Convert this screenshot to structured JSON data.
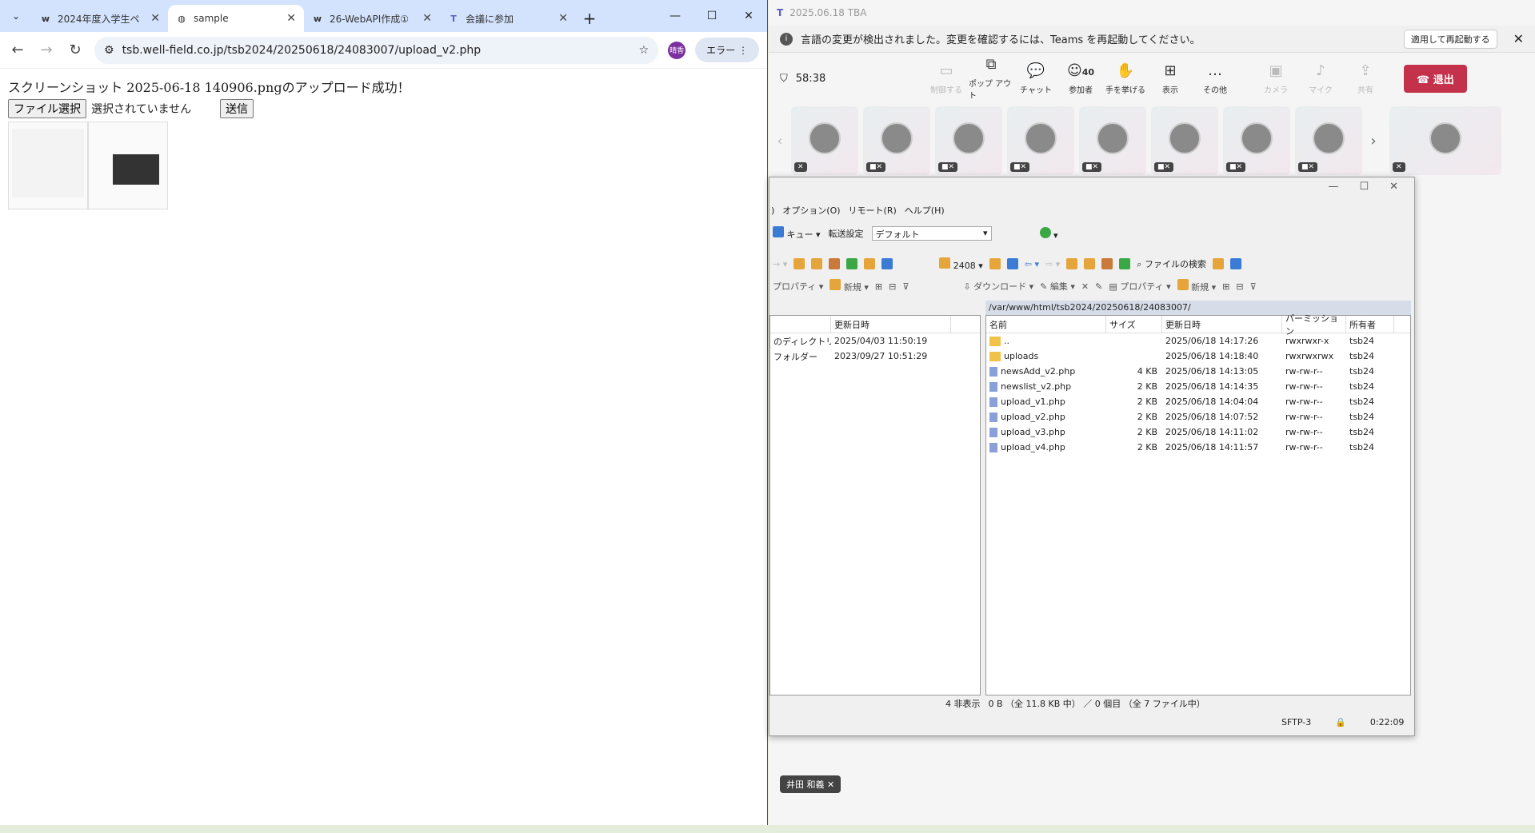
{
  "browser": {
    "tabs": [
      {
        "icon": "w",
        "title": "2024年度入学生ペ"
      },
      {
        "icon": "globe",
        "title": "sample"
      },
      {
        "icon": "w",
        "title": "26-WebAPI作成①"
      },
      {
        "icon": "teams",
        "title": "会議に参加"
      }
    ],
    "url": "tsb.well-field.co.jp/tsb2024/20250618/24083007/upload_v2.php",
    "profile": "晴香",
    "error_label": "エラー",
    "page": {
      "message": "スクリーンショット 2025-06-18 140906.pngのアップロード成功！",
      "file_button": "ファイル選択",
      "no_file": "選択されていません",
      "submit": "送信"
    }
  },
  "teams": {
    "title": "2025.06.18 TBA",
    "notice": "言語の変更が検出されました。変更を確認するには、Teams を再起動してください。",
    "restart_btn": "適用して再起動する",
    "timer": "58:38",
    "buttons": [
      {
        "label": "制御する",
        "icon": "control"
      },
      {
        "label": "ポップ アウト",
        "icon": "popout"
      },
      {
        "label": "チャット",
        "icon": "chat"
      },
      {
        "label": "参加者",
        "icon": "people",
        "count": "40"
      },
      {
        "label": "手を挙げる",
        "icon": "hand"
      },
      {
        "label": "表示",
        "icon": "grid"
      },
      {
        "label": "その他",
        "icon": "more"
      },
      {
        "label": "カメラ",
        "icon": "camera"
      },
      {
        "label": "マイク",
        "icon": "mic"
      },
      {
        "label": "共有",
        "icon": "share"
      }
    ],
    "leave": "退出",
    "participant_name": "井田 和義"
  },
  "ftp": {
    "menu": [
      "オプション(O)",
      "リモート(R)",
      "ヘルプ(H)"
    ],
    "queue": "キュー",
    "transfer_label": "転送設定",
    "transfer_value": "デフォルト",
    "dir_name": "2408",
    "find_files": "ファイルの検索",
    "download": "ダウンロード",
    "edit": "編集",
    "properties_left": "プロパティ",
    "properties_right": "プロパティ",
    "new_left": "新規",
    "new_right": "新規",
    "remote_path": "/var/www/html/tsb2024/20250618/24083007/",
    "left_header_date": "更新日時",
    "left_rows": [
      {
        "name": "のディレクトリ",
        "date": "2025/04/03 11:50:19"
      },
      {
        "name": "フォルダー",
        "date": "2023/09/27 10:51:29"
      }
    ],
    "headers": [
      "名前",
      "サイズ",
      "更新日時",
      "パーミッション",
      "所有者"
    ],
    "files": [
      {
        "name": "..",
        "size": "",
        "date": "2025/06/18 14:17:26",
        "perm": "rwxrwxr-x",
        "owner": "tsb24",
        "type": "up"
      },
      {
        "name": "uploads",
        "size": "",
        "date": "2025/06/18 14:18:40",
        "perm": "rwxrwxrwx",
        "owner": "tsb24",
        "type": "dir"
      },
      {
        "name": "newsAdd_v2.php",
        "size": "4 KB",
        "date": "2025/06/18 14:13:05",
        "perm": "rw-rw-r--",
        "owner": "tsb24",
        "type": "file"
      },
      {
        "name": "newslist_v2.php",
        "size": "2 KB",
        "date": "2025/06/18 14:14:35",
        "perm": "rw-rw-r--",
        "owner": "tsb24",
        "type": "file"
      },
      {
        "name": "upload_v1.php",
        "size": "2 KB",
        "date": "2025/06/18 14:04:04",
        "perm": "rw-rw-r--",
        "owner": "tsb24",
        "type": "file"
      },
      {
        "name": "upload_v2.php",
        "size": "2 KB",
        "date": "2025/06/18 14:07:52",
        "perm": "rw-rw-r--",
        "owner": "tsb24",
        "type": "file"
      },
      {
        "name": "upload_v3.php",
        "size": "2 KB",
        "date": "2025/06/18 14:11:02",
        "perm": "rw-rw-r--",
        "owner": "tsb24",
        "type": "file"
      },
      {
        "name": "upload_v4.php",
        "size": "2 KB",
        "date": "2025/06/18 14:11:57",
        "perm": "rw-rw-r--",
        "owner": "tsb24",
        "type": "file"
      }
    ],
    "status_hidden": "4 非表示",
    "status_summary": "0 B （全 11.8 KB 中） ／ 0 個目 （全 7 ファイル中）",
    "protocol": "SFTP-3",
    "elapsed": "0:22:09"
  }
}
